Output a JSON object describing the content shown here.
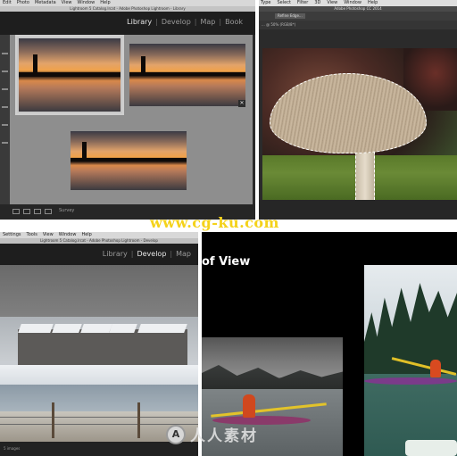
{
  "panel_lr_survey": {
    "menu": [
      "Edit",
      "Photo",
      "Metadata",
      "View",
      "Window",
      "Help"
    ],
    "window_title": "Lightroom 5 Catalog.lrcat - Adobe Photoshop Lightroom - Library",
    "modules": [
      "Library",
      "Develop",
      "Map",
      "Book"
    ],
    "active_module": "Library",
    "toolbar_label": "Survey",
    "close_glyph": "✕"
  },
  "panel_ps": {
    "menu": [
      "Type",
      "Select",
      "Filter",
      "3D",
      "View",
      "Window",
      "Help"
    ],
    "window_title": "Adobe Photoshop CC 2014",
    "refine_edge_label": "Refine Edge...",
    "doc_tab": "... @ 50% (RGB/8*)"
  },
  "watermark_top": "www.cg-ku.com",
  "panel_lr_develop": {
    "menu": [
      "Settings",
      "Tools",
      "View",
      "Window",
      "Help"
    ],
    "window_title": "Lightroom 5 Catalog.lrcat - Adobe Photoshop Lightroom - Develop",
    "modules": [
      "Library",
      "Develop",
      "Map"
    ],
    "active_module": "Develop",
    "filmstrip_label": "5 images"
  },
  "panel_presentation": {
    "slide_title": "of View"
  },
  "watermark_bottom": {
    "logo_glyph": "A",
    "text": "人人素材"
  },
  "colors": {
    "watermark_yellow": "#f4d21a",
    "lr_panel_dark": "#1e1e1e",
    "lr_survey_bg": "#8e8e8e",
    "ps_bg": "#2b2b2b",
    "kayak_jacket": "#d0481e"
  }
}
